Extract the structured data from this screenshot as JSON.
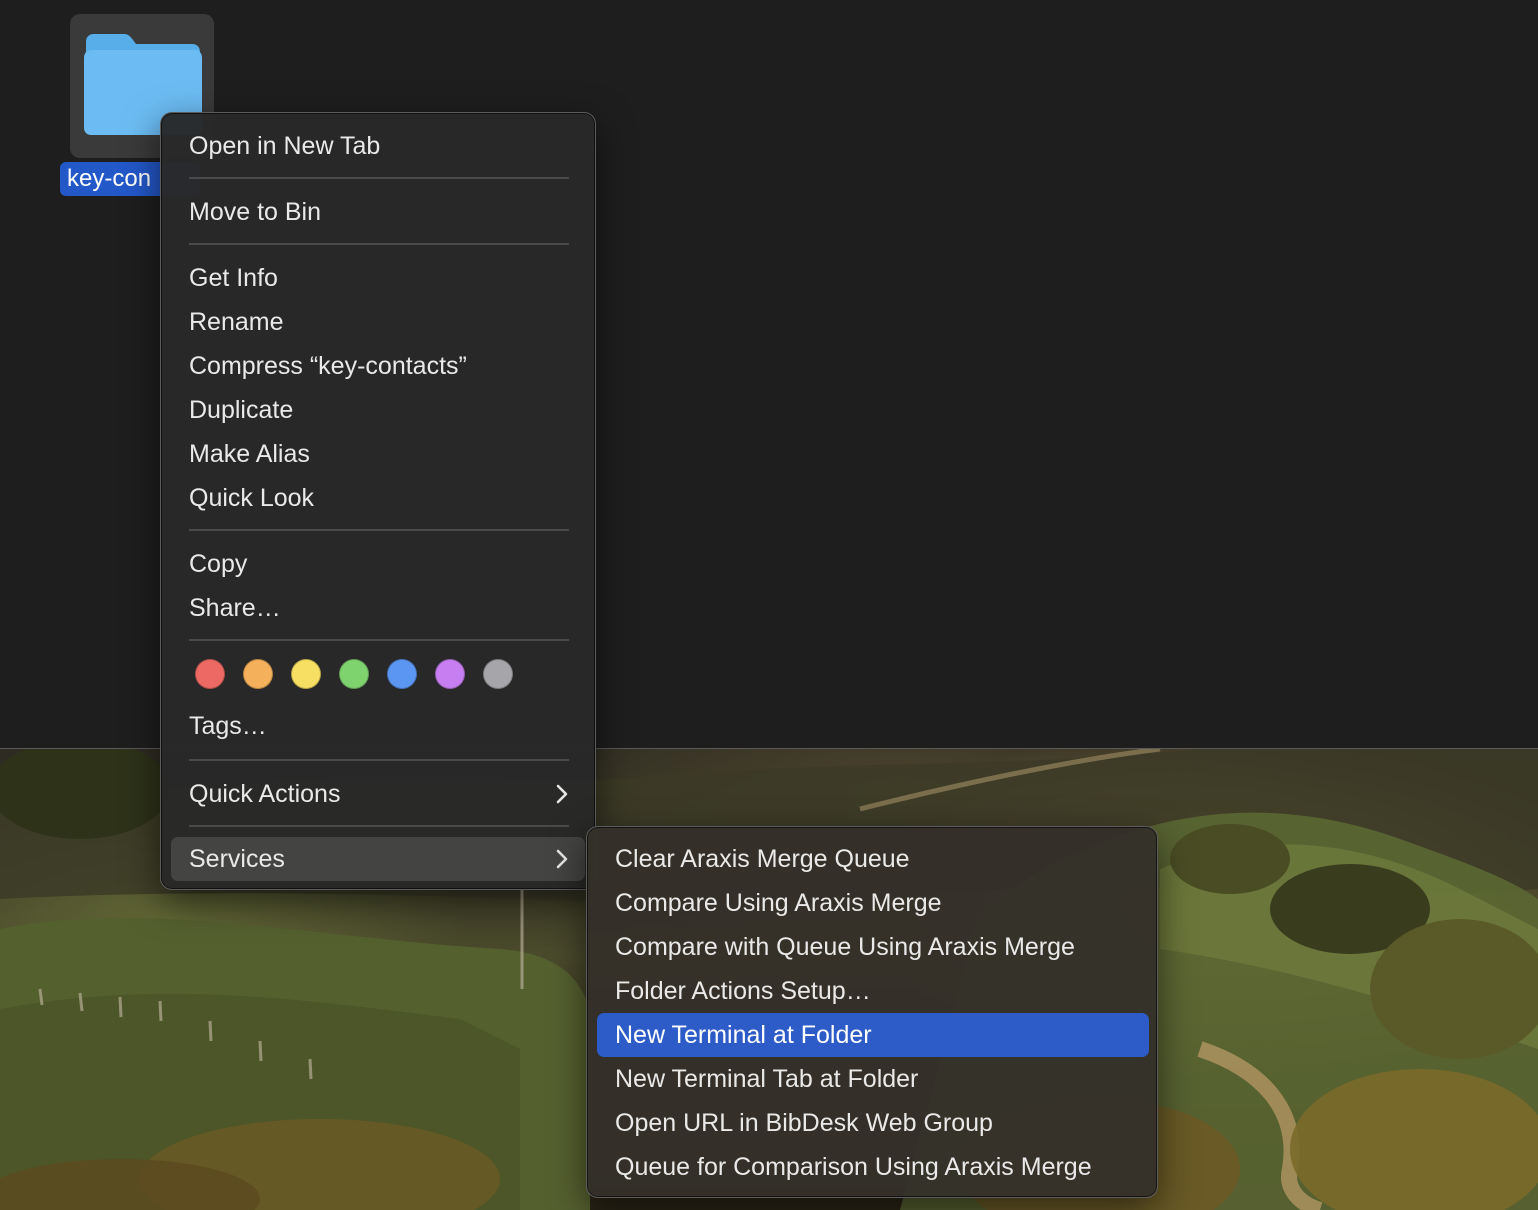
{
  "desktop": {
    "folder_label": "key-con"
  },
  "context_menu": {
    "groups": [
      [
        "Open in New Tab"
      ],
      [
        "Move to Bin"
      ],
      [
        "Get Info",
        "Rename",
        "Compress “key-contacts”",
        "Duplicate",
        "Make Alias",
        "Quick Look"
      ],
      [
        "Copy",
        "Share…"
      ]
    ],
    "tags_label": "Tags…",
    "tag_colors": [
      {
        "name": "red",
        "hex": "#ec6a63"
      },
      {
        "name": "orange",
        "hex": "#f4b05a"
      },
      {
        "name": "yellow",
        "hex": "#f6df62"
      },
      {
        "name": "green",
        "hex": "#7fd36f"
      },
      {
        "name": "blue",
        "hex": "#5b97f2"
      },
      {
        "name": "purple",
        "hex": "#c77ef0"
      },
      {
        "name": "gray",
        "hex": "#a6a6aa"
      }
    ],
    "quick_actions_label": "Quick Actions",
    "services_label": "Services"
  },
  "services_submenu": {
    "items": [
      "Clear Araxis Merge Queue",
      "Compare Using Araxis Merge",
      "Compare with Queue Using Araxis Merge",
      "Folder Actions Setup…",
      "New Terminal at Folder",
      "New Terminal Tab at Folder",
      "Open URL in BibDesk Web Group",
      "Queue for Comparison Using Araxis Merge"
    ],
    "selected": "New Terminal at Folder"
  },
  "colors": {
    "selection_blue": "#2d5bc7",
    "label_blue": "#2358c9",
    "folder_blue": "#6cbcf3"
  }
}
